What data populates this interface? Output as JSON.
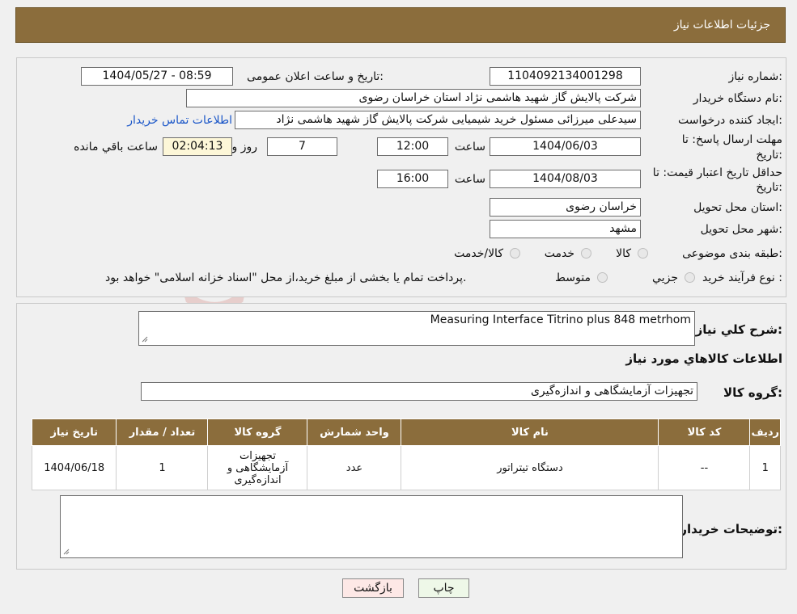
{
  "header": {
    "title": "جزئیات اطلاعات نیاز"
  },
  "form": {
    "need_number_label": "شماره نیاز:",
    "need_number": "1104092134001298",
    "announce_label": "تاریخ و ساعت اعلان عمومی:",
    "announce_value": "1404/05/27 - 08:59",
    "buyer_org_label": "نام دستگاه خریدار:",
    "buyer_org": "شرکت پالایش گاز شهید هاشمی نژاد   استان خراسان رضوی",
    "requester_label": "ایجاد کننده درخواست:",
    "requester": "سیدعلی میرزائی مسئول خرید شیمیایی شرکت پالایش گاز شهید هاشمی نژاد",
    "contact_link": "اطلاعات تماس خریدار",
    "deadline_label_1": "مهلت ارسال پاسخ: تا",
    "deadline_label_2": "تاریخ:",
    "deadline_date": "1404/06/03",
    "time_label": "ساعت",
    "deadline_time": "12:00",
    "days_value": "7",
    "days_label": "روز و",
    "remaining_time": "02:04:13",
    "remaining_label": "ساعت باقي مانده",
    "validity_label_1": "حداقل تاریخ اعتبار قیمت: تا",
    "validity_label_2": "تاریخ:",
    "validity_date": "1404/08/03",
    "validity_time": "16:00",
    "province_label": "استان محل تحویل:",
    "province": "خراسان رضوی",
    "city_label": "شهر محل تحویل:",
    "city": "مشهد",
    "category_label": "طبقه بندی موضوعی:",
    "category_options": [
      "کالا",
      "خدمت",
      "کالا/خدمت"
    ],
    "process_label": "نوع فرآیند خرید :",
    "process_options": [
      "جزیي",
      "متوسط"
    ],
    "payment_note": "پرداخت تمام یا بخشی از مبلغ خرید،از محل \"اسناد خزانه اسلامی\" خواهد بود."
  },
  "details": {
    "description_label": "شرح كلي نياز:",
    "description": "Measuring Interface Titrino plus 848 metrhom",
    "items_title": "اطلاعات كالاهاي مورد نياز",
    "group_label": "گروه کالا:",
    "group_value": "تجهیزات آزمایشگاهی و اندازه‌گیری",
    "table_headers": [
      "ردیف",
      "کد کالا",
      "نام کالا",
      "واحد شمارش",
      "گروه کالا",
      "تعداد / مقدار",
      "تاریخ نیاز"
    ],
    "table_rows": [
      [
        "1",
        "--",
        "دستگاه تیتراتور",
        "عدد",
        "تجهیزات آزمایشگاهی و اندازه‌گیری",
        "1",
        "1404/06/18"
      ]
    ],
    "buyer_notes_label": "توضیحات خریدار:",
    "buyer_notes": ""
  },
  "buttons": {
    "print": "چاپ",
    "back": "بازگشت"
  },
  "watermark": {
    "text": "AriaTender.neT"
  },
  "colors": {
    "header_bg": "#8b6d3c",
    "link": "#1a56c8",
    "print_bg": "#eef8e8",
    "back_bg": "#fde8e6"
  }
}
